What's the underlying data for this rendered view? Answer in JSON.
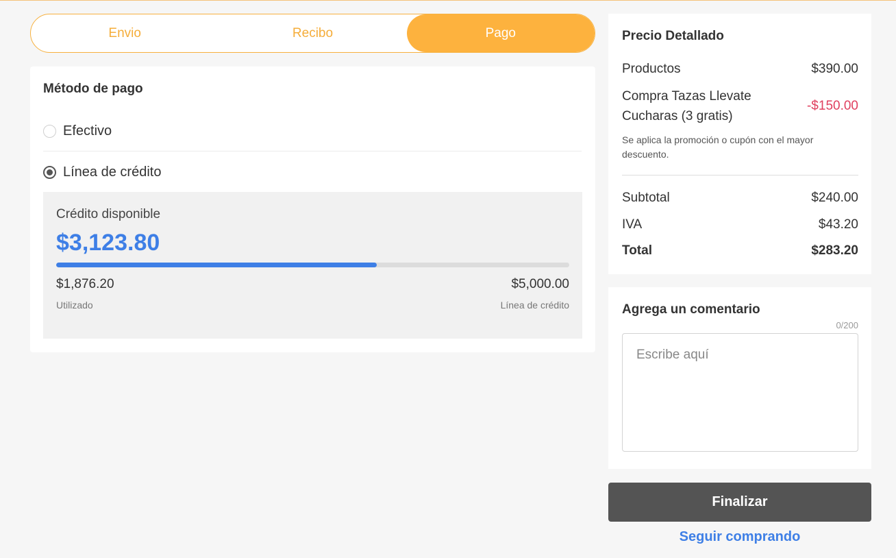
{
  "tabs": [
    {
      "label": "Envio",
      "active": false
    },
    {
      "label": "Recibo",
      "active": false
    },
    {
      "label": "Pago",
      "active": true
    }
  ],
  "payment": {
    "title": "Método de pago",
    "options": [
      {
        "label": "Efectivo",
        "selected": false
      },
      {
        "label": "Línea de crédito",
        "selected": true
      }
    ],
    "credit": {
      "label": "Crédito disponible",
      "available": "$3,123.80",
      "used_value": "$1,876.20",
      "used_label": "Utilizado",
      "limit_value": "$5,000.00",
      "limit_label": "Línea de crédito",
      "used_fraction": 0.6245
    }
  },
  "price": {
    "title": "Precio Detallado",
    "products_label": "Productos",
    "products_value": "$390.00",
    "promo_label": "Compra Tazas Llevate Cucharas (3 gratis)",
    "promo_value": "-$150.00",
    "promo_note": "Se aplica la promoción o cupón con el mayor descuento.",
    "subtotal_label": "Subtotal",
    "subtotal_value": "$240.00",
    "iva_label": "IVA",
    "iva_value": "$43.20",
    "total_label": "Total",
    "total_value": "$283.20"
  },
  "comment": {
    "title": "Agrega un comentario",
    "counter": "0/200",
    "placeholder": "Escribe aquí",
    "value": ""
  },
  "actions": {
    "finish_label": "Finalizar",
    "continue_label": "Seguir comprando"
  },
  "colors": {
    "accent": "#fdb23e",
    "link": "#3e7fe6",
    "discount": "#e0405f",
    "button": "#545454"
  }
}
